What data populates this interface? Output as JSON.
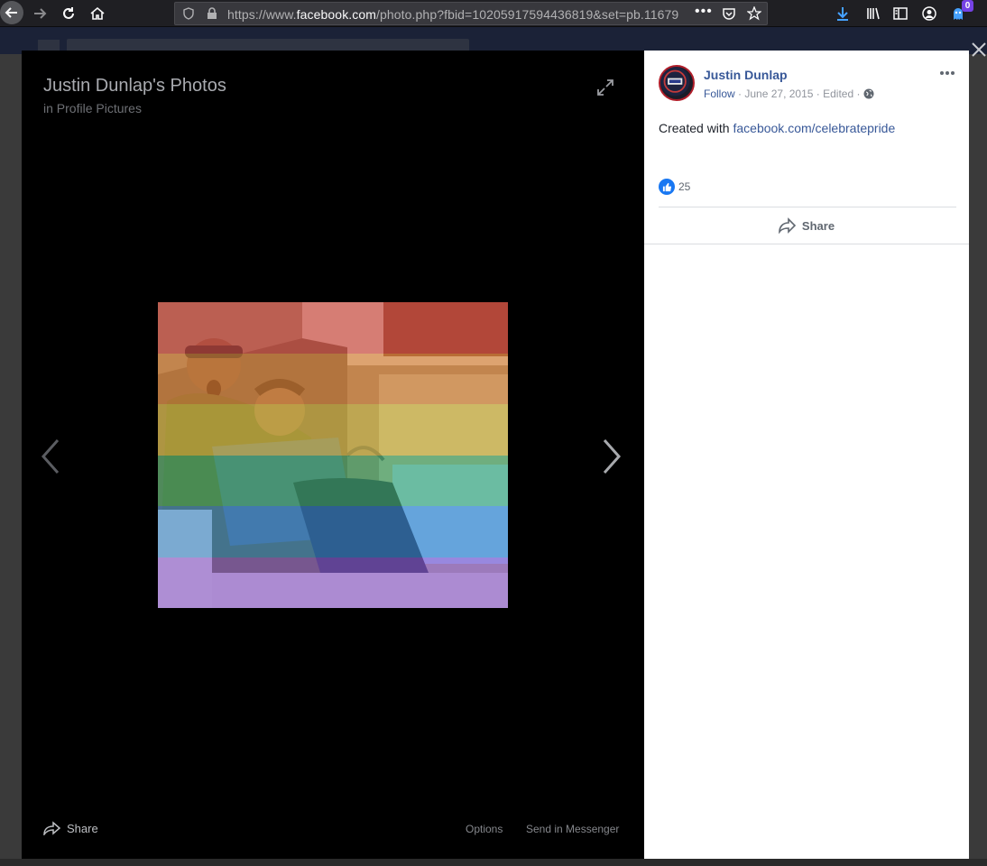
{
  "browser": {
    "url_prefix": "https://www.",
    "url_domain": "facebook.com",
    "url_rest": "/photo.php?fbid=10205917594436819&set=pb.11679",
    "notification_count": "0"
  },
  "theater": {
    "album_title": "Justin Dunlap's Photos",
    "album_sub_prefix": "in",
    "album_name": "Profile Pictures",
    "share_label": "Share",
    "options_label": "Options",
    "messenger_label": "Send in Messenger",
    "rainbow_colors": [
      "#e0453c",
      "#ed8a35",
      "#e6c63c",
      "#3bb36a",
      "#2f86d4",
      "#8c53d8"
    ]
  },
  "post": {
    "author": "Justin Dunlap",
    "follow_label": "Follow",
    "date": "June 27, 2015",
    "edited_label": "Edited",
    "caption_prefix": "Created with",
    "caption_link": "facebook.com/celebratepride",
    "like_count": "25",
    "share_label": "Share"
  },
  "colors": {
    "link": "#385898",
    "like_blue": "#1877f2",
    "theater_bg": "#000000",
    "panel_bg": "#ffffff"
  }
}
